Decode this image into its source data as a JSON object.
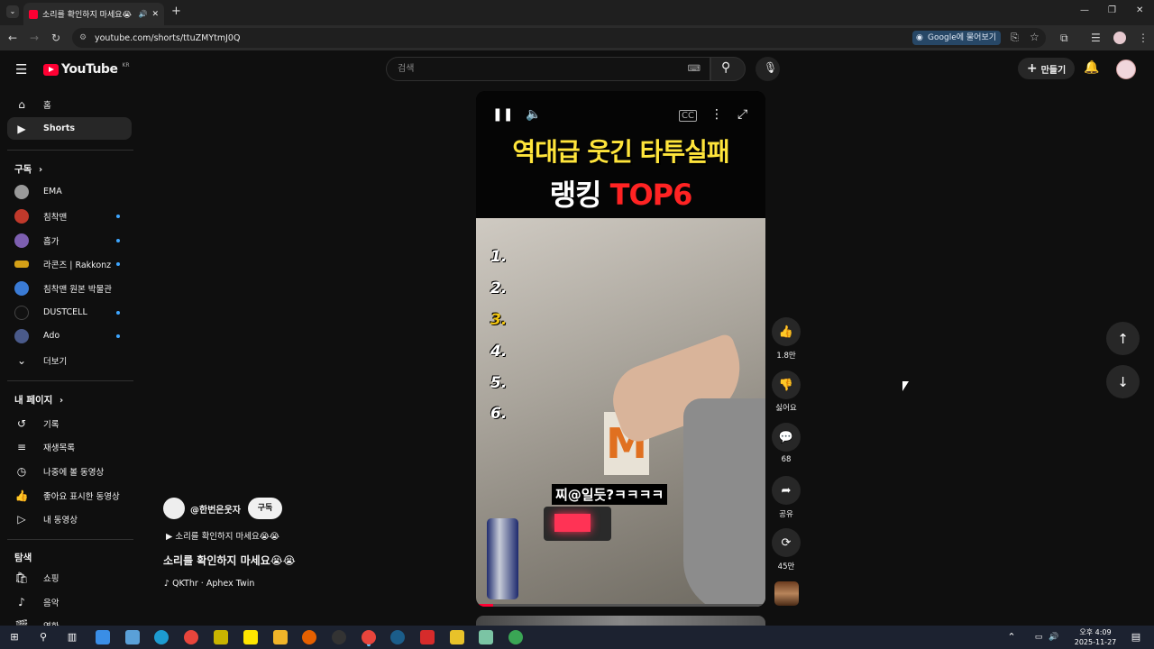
{
  "browser": {
    "tab_title": "소리를 확인하지 마세요😭",
    "new_tab": "+",
    "url": "youtube.com/shorts/ttuZMYtmJ0Q",
    "ask_google": "Google에 물어보기",
    "window_controls": [
      "—",
      "❐",
      "✕"
    ]
  },
  "masthead": {
    "logo": "YouTube",
    "logo_region": "KR",
    "search_placeholder": "검색",
    "create_label": "만들기"
  },
  "sidebar": {
    "main": [
      {
        "label": "홈",
        "icon": "home-icon"
      },
      {
        "label": "Shorts",
        "icon": "shorts-icon",
        "active": true
      }
    ],
    "subscriptions_header": "구독",
    "subscriptions": [
      {
        "label": "EMA",
        "color": "#9a9a9a",
        "dot": false
      },
      {
        "label": "침착맨",
        "color": "#c0392b",
        "dot": true
      },
      {
        "label": "흠가",
        "color": "#7d5fb0",
        "dot": true
      },
      {
        "label": "라콘즈 | Rakkonz",
        "color": "#d4a017",
        "dot": true
      },
      {
        "label": "침착맨 원본 박물관",
        "color": "#3a7bd5",
        "dot": false
      },
      {
        "label": "DUSTCELL",
        "color": "#111111",
        "dot": true
      },
      {
        "label": "Ado",
        "color": "#4a5a8a",
        "dot": true
      },
      {
        "label": "더보기",
        "color": "",
        "dot": false
      }
    ],
    "you_header": "내 페이지",
    "you": [
      {
        "label": "기록",
        "icon": "history-icon"
      },
      {
        "label": "재생목록",
        "icon": "playlist-icon"
      },
      {
        "label": "나중에 볼 동영상",
        "icon": "clock-icon"
      },
      {
        "label": "좋아요 표시한 동영상",
        "icon": "thumbs-up-icon"
      },
      {
        "label": "내 동영상",
        "icon": "my-videos-icon"
      }
    ],
    "explore_header": "탐색",
    "explore": [
      {
        "label": "쇼핑",
        "icon": "shopping-icon"
      },
      {
        "label": "음악",
        "icon": "music-icon"
      },
      {
        "label": "영화",
        "icon": "movie-icon"
      }
    ]
  },
  "video": {
    "overlay_title_line1": "역대급 웃긴 타투실패",
    "overlay_title_line2_white": "랭킹 ",
    "overlay_title_line2_red": "TOP6",
    "ranks": [
      "1.",
      "2.",
      "3.",
      "4.",
      "5.",
      "6."
    ],
    "caption": "찌@일듯?ㅋㅋㅋㅋ",
    "box_letter": "M",
    "channel": "@한번은웃자",
    "subscribe": "구독",
    "playlist": "▶ 소리를 확인하지 마세요😭😭",
    "title": "소리를 확인하지 마세요😭😭",
    "music": "♪ QKThr · Aphex Twin"
  },
  "actions": {
    "like_count": "1.8만",
    "dislike_label": "싫어요",
    "comment_count": "68",
    "share_label": "공유",
    "remix_count": "45만"
  },
  "taskbar": {
    "clock_time": "오후 4:09",
    "clock_date": "2025-11-27"
  }
}
